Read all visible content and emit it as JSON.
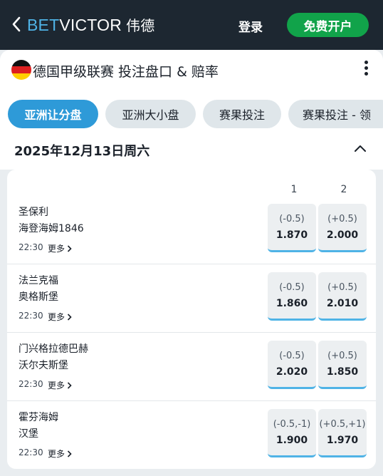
{
  "header": {
    "logo_bet": "BET",
    "logo_victor": "VICTOR",
    "logo_cn": "伟德",
    "login_label": "登录",
    "register_label": "免费开户"
  },
  "page": {
    "title": "德国甲级联赛 投注盘口 & 赔率"
  },
  "tabs": [
    {
      "label": "亚洲让分盘",
      "active": true
    },
    {
      "label": "亚洲大小盘",
      "active": false
    },
    {
      "label": "赛果投注",
      "active": false
    },
    {
      "label": "赛果投注 - 领",
      "active": false
    }
  ],
  "date_header": "2025年12月13日周六",
  "columns": [
    "1",
    "2"
  ],
  "more_label": "更多",
  "matches": [
    {
      "home": "圣保利",
      "away": "海登海姆1846",
      "time": "22:30",
      "odds": [
        {
          "hcp": "(-0.5)",
          "price": "1.870"
        },
        {
          "hcp": "(+0.5)",
          "price": "2.000"
        }
      ]
    },
    {
      "home": "法兰克福",
      "away": "奥格斯堡",
      "time": "22:30",
      "odds": [
        {
          "hcp": "(-0.5)",
          "price": "1.860"
        },
        {
          "hcp": "(+0.5)",
          "price": "2.010"
        }
      ]
    },
    {
      "home": "门兴格拉德巴赫",
      "away": "沃尔夫斯堡",
      "time": "22:30",
      "odds": [
        {
          "hcp": "(-0.5)",
          "price": "2.020"
        },
        {
          "hcp": "(+0.5)",
          "price": "1.850"
        }
      ]
    },
    {
      "home": "霍芬海姆",
      "away": "汉堡",
      "time": "22:30",
      "odds": [
        {
          "hcp": "(-0.5,-1)",
          "price": "1.900"
        },
        {
          "hcp": "(+0.5,+1)",
          "price": "1.970"
        }
      ]
    }
  ],
  "colors": {
    "topbar": "#1d2731",
    "brand_blue": "#4fb3e6",
    "register_green": "#11a34a",
    "active_tab": "#2e9ad8"
  },
  "icons": {
    "back": "chevron-left-icon",
    "menu": "kebab-menu-icon",
    "collapse": "chevron-up-icon",
    "more": "chevron-right-icon",
    "flag": "germany-flag-icon"
  }
}
